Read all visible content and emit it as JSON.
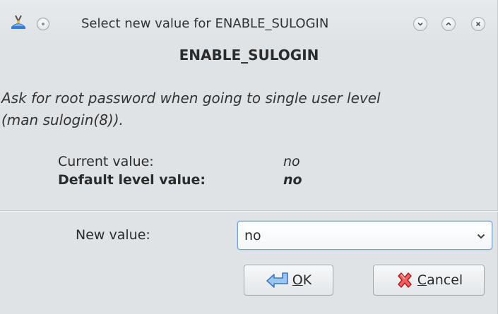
{
  "window": {
    "title": "Select new value for ENABLE_SULOGIN"
  },
  "titlebar": {
    "icons": [
      "app-icon",
      "pin-icon",
      "minimize-icon",
      "maximize-icon",
      "close-icon"
    ]
  },
  "content": {
    "variable_name": "ENABLE_SULOGIN",
    "description": "Ask for root password when going to single user level\n(man sulogin(8)).",
    "current_label": "Current value:",
    "current_value": "no",
    "default_label": "Default level value:",
    "default_value": "no",
    "new_value_label": "New value:",
    "new_value_selected": "no"
  },
  "buttons": {
    "ok_mnemonic": "O",
    "ok_rest": "K",
    "cancel_mnemonic": "C",
    "cancel_rest": "ancel"
  },
  "colors": {
    "focus_border": "#6fa0d0",
    "ok_icon": "#3a78c8",
    "cancel_icon": "#d02020"
  }
}
